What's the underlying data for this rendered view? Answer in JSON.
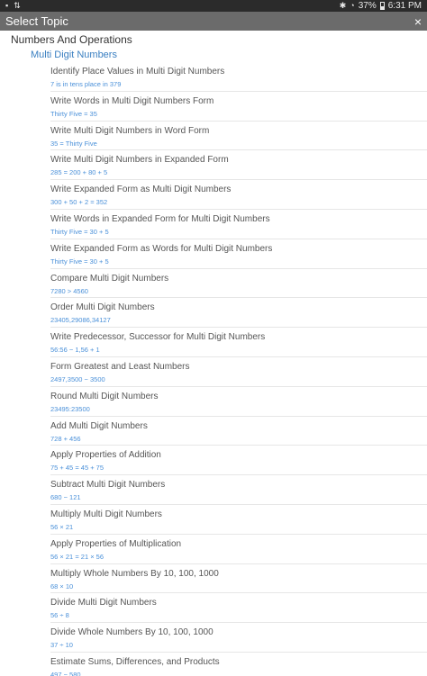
{
  "status_bar": {
    "left_icons": [
      "image-icon",
      "transfer-icon"
    ],
    "bluetooth": "bluetooth-icon",
    "wifi": "wifi-icon",
    "battery_percent": "37%",
    "battery_level": 0.37,
    "time": "6:31 PM"
  },
  "dialog": {
    "title": "Select Topic",
    "close_label": "×"
  },
  "tree": {
    "category": "Numbers And Operations",
    "subcategory": "Multi Digit Numbers",
    "topics": [
      {
        "title": "Identify Place Values in Multi Digit Numbers",
        "example": "7 is in tens place in 379"
      },
      {
        "title": "Write Words in Multi Digit Numbers Form",
        "example": "Thirty Five = 35"
      },
      {
        "title": "Write Multi Digit Numbers in Word Form",
        "example": "35 = Thirty Five"
      },
      {
        "title": "Write Multi Digit Numbers in Expanded Form",
        "example": "285 = 200 + 80 + 5"
      },
      {
        "title": "Write Expanded Form as Multi Digit Numbers",
        "example": "300 + 50 + 2 = 352"
      },
      {
        "title": "Write Words in Expanded Form for Multi Digit Numbers",
        "example": "Thirty Five = 30 + 5"
      },
      {
        "title": "Write Expanded Form as Words for Multi Digit Numbers",
        "example": "Thirty Five = 30 + 5"
      },
      {
        "title": "Compare Multi Digit Numbers",
        "example": "7280 > 4560"
      },
      {
        "title": "Order Multi Digit Numbers",
        "example": "23405,29086,34127"
      },
      {
        "title": "Write Predecessor, Successor for Multi Digit Numbers",
        "example": "56:56 − 1,56 + 1"
      },
      {
        "title": "Form Greatest and Least Numbers",
        "example": "2497,3500 − 3500"
      },
      {
        "title": "Round Multi Digit Numbers",
        "example": "23495:23500"
      },
      {
        "title": "Add Multi Digit Numbers",
        "example": "728 + 456"
      },
      {
        "title": "Apply Properties of Addition",
        "example": "75 + 45 = 45 + 75"
      },
      {
        "title": "Subtract Multi Digit Numbers",
        "example": "680 − 121"
      },
      {
        "title": "Multiply Multi Digit Numbers",
        "example": "56 × 21"
      },
      {
        "title": "Apply Properties of Multiplication",
        "example": "56 × 21 = 21 × 56"
      },
      {
        "title": "Multiply Whole Numbers By 10, 100, 1000",
        "example": "68 × 10"
      },
      {
        "title": "Divide Multi Digit Numbers",
        "example": "56 ÷ 8"
      },
      {
        "title": "Divide Whole Numbers By 10, 100, 1000",
        "example": "37 ÷ 10"
      },
      {
        "title": "Estimate Sums, Differences, and Products",
        "example": "497 − 580"
      }
    ]
  }
}
